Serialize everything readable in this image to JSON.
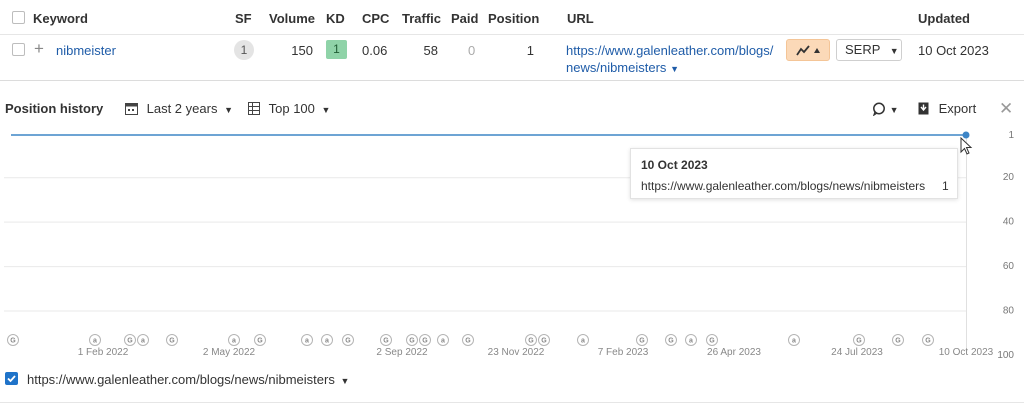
{
  "table": {
    "headers": {
      "keyword": "Keyword",
      "sf": "SF",
      "volume": "Volume",
      "kd": "KD",
      "cpc": "CPC",
      "traffic": "Traffic",
      "paid": "Paid",
      "position": "Position",
      "url": "URL",
      "updated": "Updated"
    },
    "row": {
      "keyword": "nibmeister",
      "sf": "1",
      "volume": "150",
      "kd": "1",
      "cpc": "0.06",
      "traffic": "58",
      "paid": "0",
      "position": "1",
      "url_line1": "https://www.galenleather.com/blogs/",
      "url_line2": "news/nibmeisters",
      "serp_label": "SERP",
      "updated": "10 Oct 2023"
    }
  },
  "history": {
    "title": "Position history",
    "range_label": "Last 2 years",
    "top_label": "Top 100",
    "export_label": "Export"
  },
  "tooltip": {
    "date": "10 Oct 2023",
    "url": "https://www.galenleather.com/blogs/news/nibmeisters",
    "position": "1"
  },
  "chart_data": {
    "type": "line",
    "y_reversed": true,
    "ylim": [
      1,
      100
    ],
    "ytick_labels": [
      "1",
      "20",
      "40",
      "60",
      "80",
      "100"
    ],
    "xtick_labels": [
      "1 Feb 2022",
      "2 May 2022",
      "2 Sep 2022",
      "23 Nov 2022",
      "7 Feb 2023",
      "26 Apr 2023",
      "24 Jul 2023",
      "10 Oct 2023"
    ],
    "series": [
      {
        "name": "https://www.galenleather.com/blogs/news/nibmeisters",
        "color": "#3d85c6",
        "x": [
          "Oct 2021",
          "10 Oct 2023"
        ],
        "y": [
          1,
          1
        ]
      }
    ],
    "annotations": [
      "G",
      "a",
      "G",
      "a",
      "G",
      "a",
      "G",
      "a",
      "a",
      "G",
      "G",
      "G",
      "G",
      "a",
      "G",
      "G",
      "G",
      "a",
      "G",
      "G",
      "a",
      "G",
      "a",
      "G",
      "G",
      "G"
    ]
  },
  "legend": {
    "url": "https://www.galenleather.com/blogs/news/nibmeisters",
    "checked": true
  },
  "colors": {
    "accent": "#3d85c6",
    "link": "#1f5ca8",
    "kd_green": "#8fd3a8",
    "trend_orange": "#fbd9b8"
  }
}
